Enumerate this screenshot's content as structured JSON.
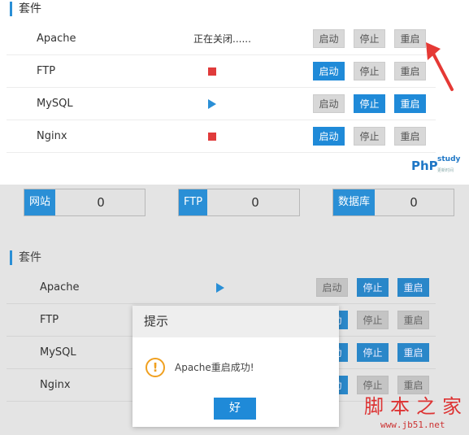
{
  "top": {
    "section_title": "套件",
    "rows": [
      {
        "name": "Apache",
        "status_text": "正在关闭......",
        "status_kind": "text",
        "start": "启动",
        "stop": "停止",
        "restart": "重启",
        "start_on": false,
        "stop_on": false,
        "restart_on": false
      },
      {
        "name": "FTP",
        "status_text": "",
        "status_kind": "stopped",
        "start": "启动",
        "stop": "停止",
        "restart": "重启",
        "start_on": true,
        "stop_on": false,
        "restart_on": false
      },
      {
        "name": "MySQL",
        "status_text": "",
        "status_kind": "running",
        "start": "启动",
        "stop": "停止",
        "restart": "重启",
        "start_on": false,
        "stop_on": true,
        "restart_on": true
      },
      {
        "name": "Nginx",
        "status_text": "",
        "status_kind": "stopped",
        "start": "启动",
        "stop": "停止",
        "restart": "重启",
        "start_on": true,
        "stop_on": false,
        "restart_on": false
      }
    ],
    "logo": {
      "main": "PhP",
      "sup": "study",
      "sub": "更新时间"
    }
  },
  "stats": [
    {
      "label": "网站",
      "value": "0"
    },
    {
      "label": "FTP",
      "value": "0"
    },
    {
      "label": "数据库",
      "value": "0"
    }
  ],
  "lower": {
    "section_title": "套件",
    "rows": [
      {
        "name": "Apache",
        "status_kind": "running",
        "start": "启动",
        "stop": "停止",
        "restart": "重启",
        "start_on": false,
        "stop_on": true,
        "restart_on": true
      },
      {
        "name": "FTP",
        "status_kind": "",
        "start": "启动",
        "stop": "停止",
        "restart": "重启",
        "start_on": true,
        "stop_on": false,
        "restart_on": false
      },
      {
        "name": "MySQL",
        "status_kind": "",
        "start": "启动",
        "stop": "停止",
        "restart": "重启",
        "start_on": true,
        "stop_on": true,
        "restart_on": true
      },
      {
        "name": "Nginx",
        "status_kind": "",
        "start": "启动",
        "stop": "停止",
        "restart": "重启",
        "start_on": true,
        "stop_on": false,
        "restart_on": false
      }
    ]
  },
  "dialog": {
    "title": "提示",
    "message": "Apache重启成功!",
    "ok": "好",
    "icon": "info-icon"
  },
  "watermark": {
    "cn": "脚本之家",
    "url": "www.jb51.net"
  },
  "colors": {
    "accent": "#1f8ad8",
    "stopped": "#e03b3b",
    "arrow": "#e53935"
  }
}
